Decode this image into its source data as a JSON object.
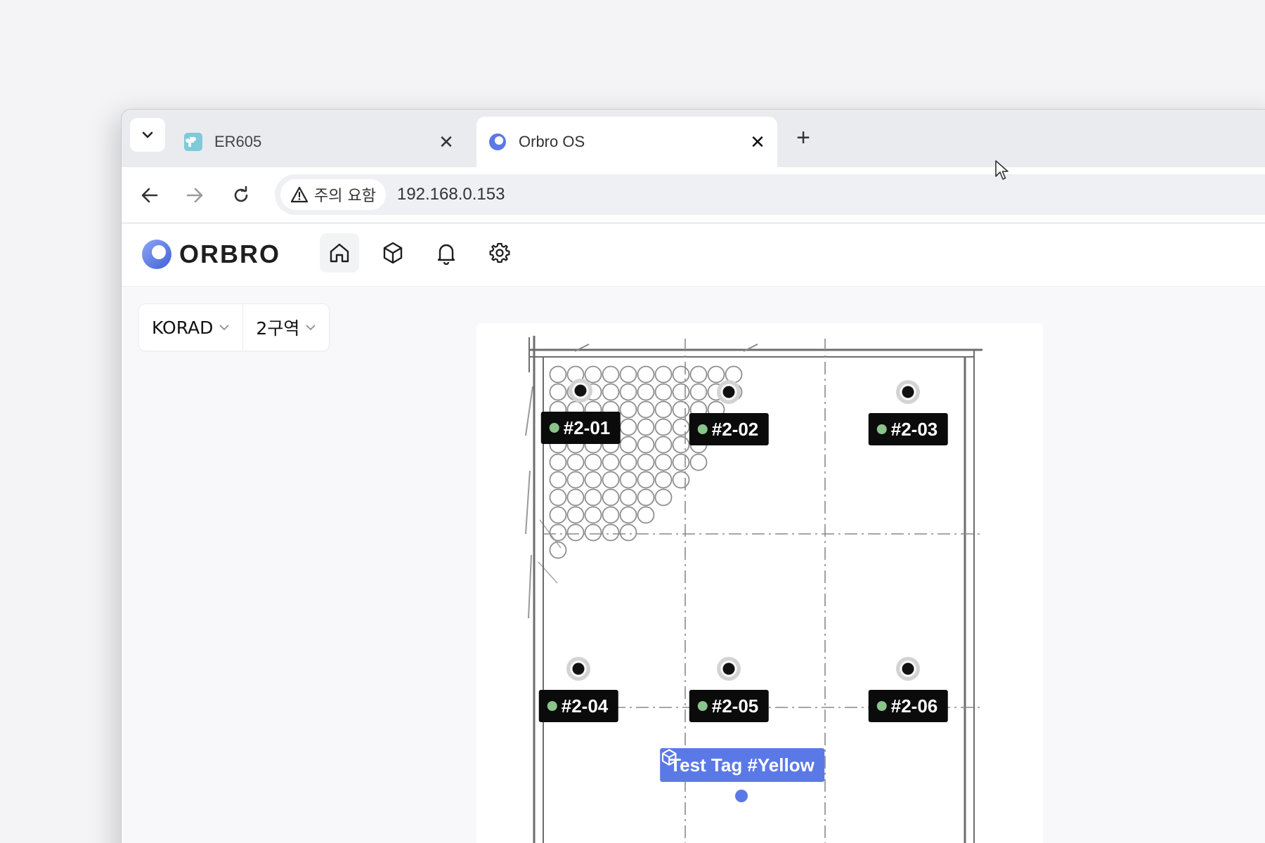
{
  "browser": {
    "tabs": [
      {
        "title": "ER605",
        "active": false,
        "favicon": "puzzle-favicon-icon",
        "close": "✕"
      },
      {
        "title": "Orbro OS",
        "active": true,
        "favicon": "orbro-favicon-icon",
        "close": "✕"
      }
    ],
    "new_tab": "+",
    "security_label": "주의 요함",
    "url": "192.168.0.153"
  },
  "app": {
    "logo_text": "ORBRO",
    "nav": [
      "home-icon",
      "box-icon",
      "bell-icon",
      "gear-icon"
    ],
    "site_selector": "KORAD",
    "zone_selector": "2구역",
    "colors": {
      "accent": "#5b79e6",
      "online": "#8bc48a"
    }
  },
  "map": {
    "zones": [
      {
        "label": "#2-01"
      },
      {
        "label": "#2-02"
      },
      {
        "label": "#2-03"
      },
      {
        "label": "#2-04"
      },
      {
        "label": "#2-05"
      },
      {
        "label": "#2-06"
      }
    ],
    "tag": {
      "label": "Test Tag #Yellow",
      "icon": "box-icon"
    }
  }
}
